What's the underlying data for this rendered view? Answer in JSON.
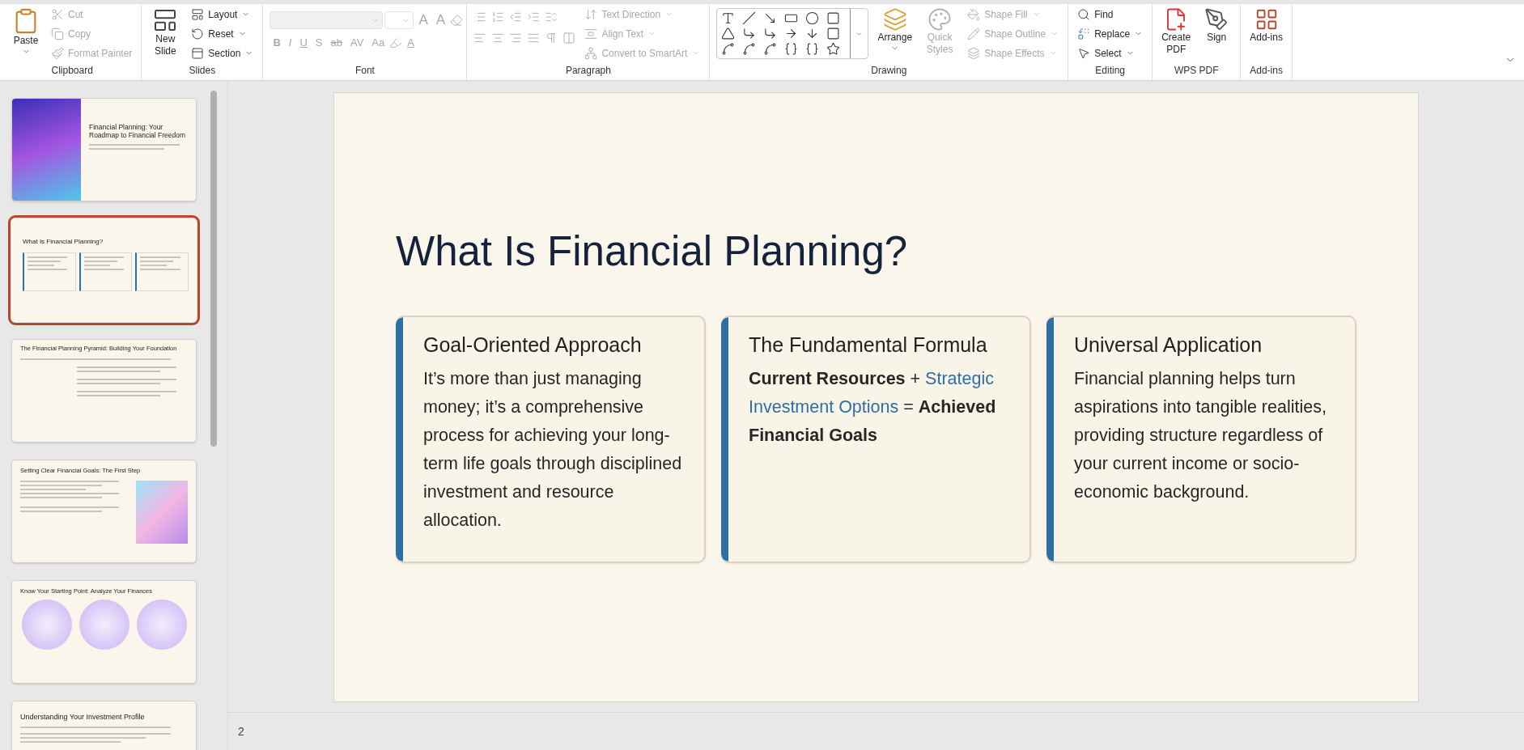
{
  "ribbon": {
    "clipboard": {
      "label": "Clipboard",
      "paste": "Paste",
      "items": [
        {
          "label": "Cut",
          "disabled": true
        },
        {
          "label": "Copy",
          "disabled": true
        },
        {
          "label": "Format Painter",
          "disabled": true
        }
      ]
    },
    "slides": {
      "label": "Slides",
      "new_slide": "New Slide",
      "items": [
        {
          "label": "Layout",
          "disabled": false
        },
        {
          "label": "Reset",
          "disabled": false
        },
        {
          "label": "Section",
          "disabled": false
        }
      ]
    },
    "font": {
      "label": "Font",
      "size_buttons": [
        "A",
        "A"
      ],
      "format_buttons": [
        "B",
        "I",
        "U",
        "S",
        "ab",
        "AV",
        "Aa"
      ],
      "color_button": "A",
      "disabled": true
    },
    "paragraph": {
      "label": "Paragraph",
      "items": [
        {
          "label": "Text Direction",
          "disabled": true
        },
        {
          "label": "Align Text",
          "disabled": true
        },
        {
          "label": "Convert to SmartArt",
          "disabled": true
        }
      ]
    },
    "drawing": {
      "label": "Drawing",
      "arrange": "Arrange",
      "quick_styles": {
        "label": "Quick Styles",
        "disabled": true
      },
      "items": [
        {
          "label": "Shape Fill",
          "disabled": true
        },
        {
          "label": "Shape Outline",
          "disabled": true
        },
        {
          "label": "Shape Effects",
          "disabled": true
        }
      ]
    },
    "editing": {
      "label": "Editing",
      "items": [
        {
          "label": "Find",
          "disabled": false
        },
        {
          "label": "Replace",
          "disabled": false
        },
        {
          "label": "Select",
          "disabled": false
        }
      ]
    },
    "wps_pdf": {
      "label": "WPS PDF",
      "items": [
        {
          "label": "Create PDF",
          "kind": "pdf"
        },
        {
          "label": "Sign",
          "kind": "sign"
        }
      ]
    },
    "add_ins": {
      "label": "Add-ins",
      "button": "Add-ins"
    }
  },
  "thumbnails": [
    {
      "kind": "cover",
      "title": "Financial Planning: Your Roadmap to Financial Freedom",
      "selected": false
    },
    {
      "kind": "cards",
      "title": "What Is Financial Planning?",
      "selected": true
    },
    {
      "kind": "pyramid",
      "title": "The Financial Planning Pyramid: Building Your Foundation",
      "selected": false
    },
    {
      "kind": "goals",
      "title": "Setting Clear Financial Goals: The First Step",
      "selected": false
    },
    {
      "kind": "circles",
      "title": "Know Your Starting Point: Analyze Your Finances",
      "selected": false
    },
    {
      "kind": "profile",
      "title": "Understanding Your Investment Profile",
      "selected": false
    }
  ],
  "slide": {
    "title": "What Is Financial Planning?",
    "cards": [
      {
        "heading": "Goal-Oriented Approach",
        "body": [
          {
            "kind": "plain",
            "text": "It’s more than just managing money; it’s a comprehensive process for achieving your long-term life goals through disciplined investment and resource allocation."
          }
        ]
      },
      {
        "heading": "The Fundamental Formula",
        "body": [
          {
            "kind": "bold",
            "text": "Current Resources"
          },
          {
            "kind": "plain",
            "text": " + "
          },
          {
            "kind": "link",
            "text": "Strategic Investment Options"
          },
          {
            "kind": "plain",
            "text": " = "
          },
          {
            "kind": "bold",
            "text": "Achieved Financial Goals"
          }
        ]
      },
      {
        "heading": "Universal Application",
        "body": [
          {
            "kind": "plain",
            "text": "Financial planning helps turn aspirations into tangible realities, providing structure regardless of your current income or socio-economic background."
          }
        ]
      }
    ]
  },
  "status_bar": {
    "slide_number": "2"
  }
}
